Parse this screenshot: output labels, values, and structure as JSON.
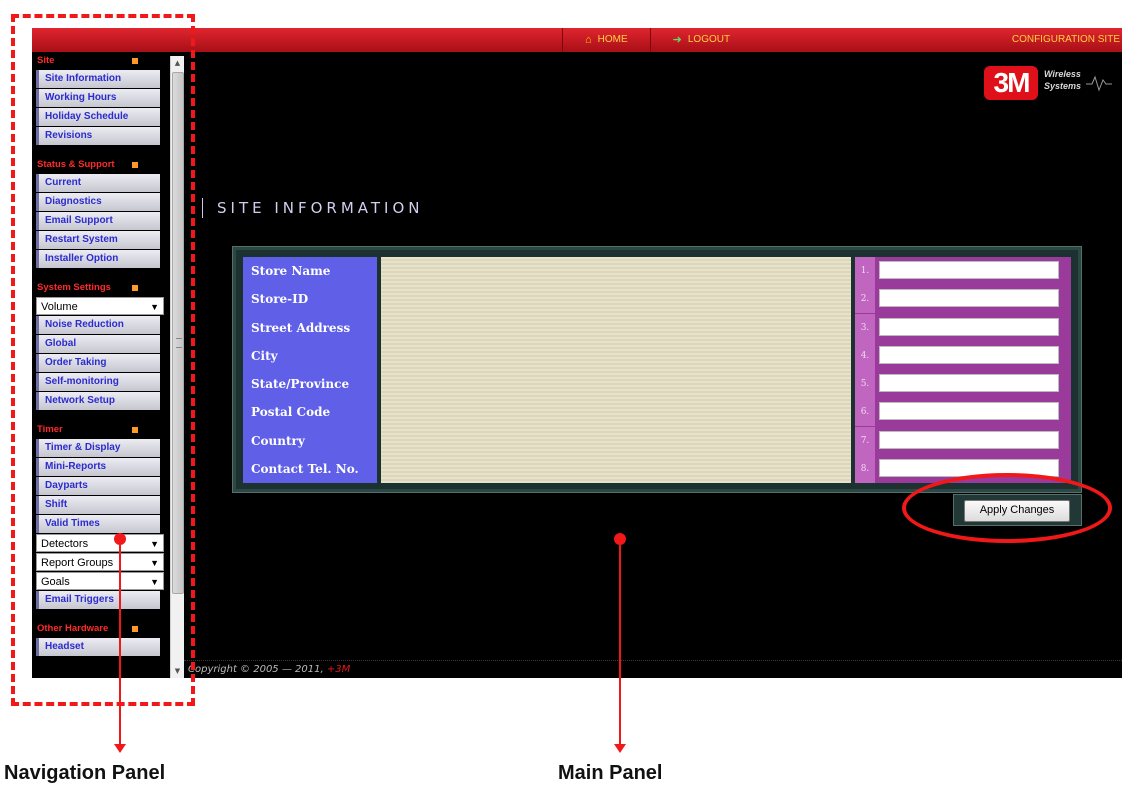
{
  "topbar": {
    "home": "Home",
    "logout": "Logout",
    "right_title": "Configuration Site"
  },
  "sidebar": {
    "sections": [
      {
        "title": "Site",
        "items": [
          {
            "type": "link",
            "label": "Site Information"
          },
          {
            "type": "link",
            "label": "Working Hours"
          },
          {
            "type": "link",
            "label": "Holiday Schedule"
          },
          {
            "type": "link",
            "label": "Revisions"
          }
        ]
      },
      {
        "title": "Status & Support",
        "items": [
          {
            "type": "link",
            "label": "Current"
          },
          {
            "type": "link",
            "label": "Diagnostics"
          },
          {
            "type": "link",
            "label": "Email Support"
          },
          {
            "type": "link",
            "label": "Restart System"
          },
          {
            "type": "link",
            "label": "Installer Option"
          }
        ]
      },
      {
        "title": "System Settings",
        "items": [
          {
            "type": "dropdown",
            "label": "Volume"
          },
          {
            "type": "link",
            "label": "Noise Reduction"
          },
          {
            "type": "link",
            "label": "Global"
          },
          {
            "type": "link",
            "label": "Order Taking"
          },
          {
            "type": "link",
            "label": "Self-monitoring"
          },
          {
            "type": "link",
            "label": "Network Setup"
          }
        ]
      },
      {
        "title": "Timer",
        "items": [
          {
            "type": "link",
            "label": "Timer & Display"
          },
          {
            "type": "link",
            "label": "Mini-Reports"
          },
          {
            "type": "link",
            "label": "Dayparts"
          },
          {
            "type": "link",
            "label": "Shift"
          },
          {
            "type": "link",
            "label": "Valid Times"
          },
          {
            "type": "dropdown",
            "label": "Detectors"
          },
          {
            "type": "dropdown",
            "label": "Report Groups"
          },
          {
            "type": "dropdown",
            "label": "Goals"
          },
          {
            "type": "link",
            "label": "Email Triggers"
          }
        ]
      },
      {
        "title": "Other Hardware",
        "items": [
          {
            "type": "link",
            "label": "Headset"
          }
        ]
      }
    ]
  },
  "logo": {
    "mark": "3M",
    "line1": "Wireless",
    "line2": "Systems"
  },
  "main": {
    "title": "SITE INFORMATION",
    "fields": [
      {
        "label": "Store Name",
        "number": "1."
      },
      {
        "label": "Store-ID",
        "number": "2."
      },
      {
        "label": "Street Address",
        "number": "3."
      },
      {
        "label": "City",
        "number": "4."
      },
      {
        "label": "State/Province",
        "number": "5."
      },
      {
        "label": "Postal Code",
        "number": "6."
      },
      {
        "label": "Country",
        "number": "7."
      },
      {
        "label": "Contact Tel. No.",
        "number": "8."
      }
    ],
    "apply_label": "Apply Changes"
  },
  "footer": {
    "text": "Copyright © 2005 — 2011, ",
    "brand": "+3M"
  },
  "annotations": {
    "nav_label": "Navigation Panel",
    "main_label": "Main Panel",
    "color": "#f01818"
  }
}
